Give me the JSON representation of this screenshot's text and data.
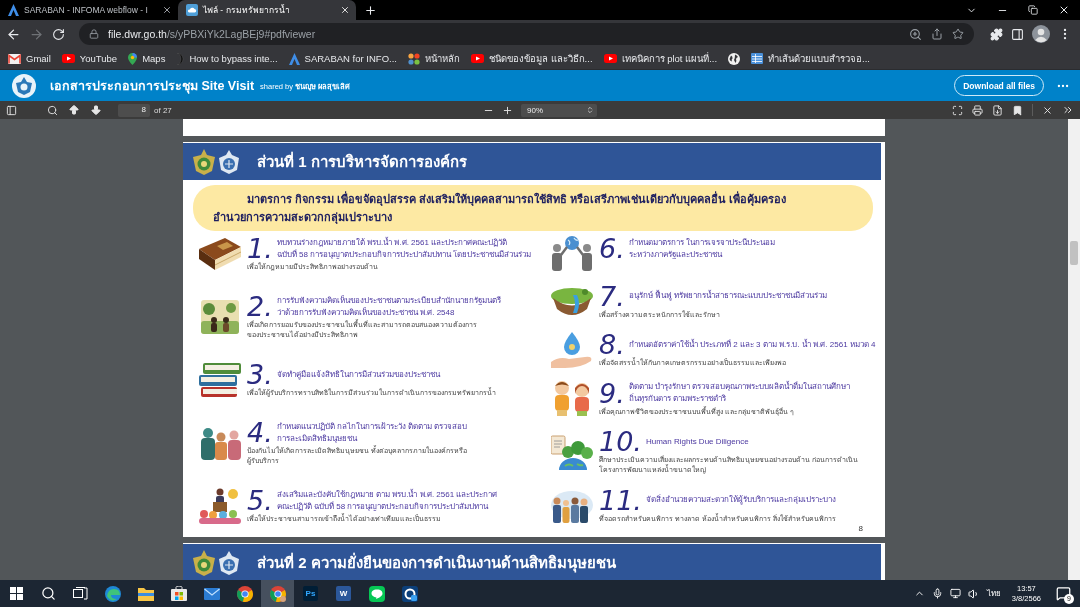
{
  "browser": {
    "tabs": [
      {
        "title": "SARABAN - INFOMA webflow - I",
        "kind": "saraban",
        "selected": false
      },
      {
        "title": "ไฟล์ - กรมทรัพยากรน้ำ",
        "kind": "cloud",
        "selected": true
      }
    ],
    "forward_disabled": true,
    "address": {
      "host": "file.dwr.go.th",
      "path": "/s/yPBXiYk2LagBEj9#pdfviewer"
    },
    "bookmarks": [
      {
        "kind": "gmail",
        "label": "Gmail"
      },
      {
        "kind": "youtube",
        "label": "YouTube"
      },
      {
        "kind": "maps",
        "label": "Maps"
      },
      {
        "kind": "dark",
        "label": "How to bypass inte..."
      },
      {
        "kind": "saraban",
        "label": "SARABAN for INFO..."
      },
      {
        "kind": "joomla",
        "label": "หน้าหลัก"
      },
      {
        "kind": "youtube",
        "label": "ชนิดของข้อมูล และวิธีก..."
      },
      {
        "kind": "youtube",
        "label": "เทคนิคการ plot แผนที่..."
      },
      {
        "kind": "globe"
      },
      {
        "kind": "sheet",
        "label": "ทำเส้นด้วยแบบสำรวจอ..."
      }
    ]
  },
  "share_header": {
    "title": "เอกสารประกอบการประชุม Site Visit",
    "shared_by": "shared by **ชนญุษ ผลสุขเลิศ**",
    "download_button": "Download all files"
  },
  "pdf_toolbar": {
    "page": "8",
    "page_count": "of 27",
    "zoom": "90%"
  },
  "document": {
    "page": {
      "section_title": "ส่วนที่ 1 การบริหารจัดการองค์กร",
      "intro": "มาตรการ กิจกรรม เพื่อขจัดอุปสรรค ส่งเสริมให้บุคคลสามารถใช้สิทธิ หรือเสรีภาพเช่นเดียวกับบุคคลอื่น เพื่อคุ้มครอง\nอำนวยการความสะดวกกลุ่มเปราะบาง",
      "columns": [
        {
          "items": [
            {
              "kind": "law-book",
              "number": "1.",
              "title": "ทบทวนร่างกฎหมายภายใต้ พรบ.น้ำ พ.ศ. 2561 และประกาศคณะปฏิวัติ\nฉบับที่ 58 การอนุญาตประกอบกิจการประปาสัมปทาน โดยประชาชนมีส่วนร่วม",
              "note": "เพื่อให้กฎหมายมีประสิทธิภาพอย่างรอบด้าน"
            },
            {
              "kind": "village",
              "number": "2.",
              "title": "การรับฟังความคิดเห็นของประชาชนตามระเบียบสำนักนายกรัฐมนตรี\nว่าด้วยการรับฟังความคิดเห็นของประชาชน พ.ศ. 2548",
              "note": "เพื่อเกิดการยอมรับของประชาชนในพื้นที่และสามารถตอบสนองความต้องการ\nของประชาชนได้อย่างมีประสิทธิภาพ"
            },
            {
              "kind": "books",
              "number": "3.",
              "title": "จัดทำคู่มือแจ้งสิทธิในการมีส่วนร่วมของประชาชน",
              "note": "เพื่อให้ผู้รับบริการทราบสิทธิในการมีส่วนร่วมในการดำเนินการของกรมทรัพยากรน้ำ"
            },
            {
              "kind": "meeting",
              "number": "4.",
              "title": "กำหนดแนวปฏิบัติ กลไกในการเฝ้าระวัง ติดตาม ตรวจสอบ\nการละเมิดสิทธิมนุษยชน",
              "note": "ป้องกันไม่ให้เกิดการละเมิดสิทธิมนุษยชน ทั้งต่อบุคลากรภายในองค์กรหรือ\nผู้รับบริการ"
            },
            {
              "kind": "speaker",
              "number": "5.",
              "title": "ส่งเสริมและบังคับใช้กฎหมาย ตาม พรบ.น้ำ พ.ศ. 2561 และประกาศ\nคณะปฏิวัติ ฉบับที่ 58 การอนุญาตประกอบกิจการประปาสัมปทาน",
              "note": "เพื่อให้ประชาชนสามารถเข้าถึงน้ำได้อย่างเท่าเทียมและเป็นธรรม"
            }
          ]
        },
        {
          "items": [
            {
              "kind": "globe-people",
              "number": "6.",
              "title": "กำหนดมาตรการ ในการเจรจาประนีประนอม\nระหว่างภาครัฐและประชาชน"
            },
            {
              "kind": "island",
              "number": "7.",
              "title": "อนุรักษ์ ฟื้นฟู ทรัพยากรน้ำสาธารณะแบบประชาชนมีส่วนร่วม",
              "note": "เพื่อสร้างความตระหนักการใช้และรักษา"
            },
            {
              "kind": "water-hand",
              "number": "8.",
              "title": "กำหนดอัตราค่าใช้น้ำ ประเภทที่ 2 และ 3 ตาม พ.ร.บ. น้ำ พ.ศ. 2561 หมวด 4",
              "note": "เพื่อจัดสรรน้ำให้กับภาคเกษตรกรรมอย่างเป็นธรรมและเพียงพอ"
            },
            {
              "kind": "children",
              "number": "9.",
              "title": "ติดตาม บำรุงรักษา ตรวจสอบคุณภาพระบบผลิตน้ำดื่มในสถานศึกษา\nถิ่นทุรกันดาร ตามพระราชดำริ",
              "note": "เพื่อคุณภาพชีวิตของประชาชนบนพื้นที่สูง และกลุ่มชาติพันธุ์อื่น ๆ"
            },
            {
              "kind": "earth",
              "number": "10.",
              "title": "Human Rights Due Diligence",
              "note": "ศึกษาประเมินความเสี่ยงและผลกระทบด้านสิทธิมนุษยชนอย่างรอบด้าน ก่อนการดำเนิน\nโครงการพัฒนาแหล่งน้ำขนาดใหญ่"
            },
            {
              "kind": "crowd",
              "number": "11.",
              "title": "จัดสิ่งอำนวยความสะดวกให้ผู้รับบริการและกลุ่มเปราะบาง",
              "note": "ที่จอดรถสำหรับคนพิการ ทางลาด ห้องน้ำสำหรับคนพิการ สิ่งใช้สำหรับคนพิการ"
            }
          ]
        }
      ],
      "page_number": "8"
    },
    "next_page": {
      "section_title": "ส่วนที่ 2 ความยั่งยืนของการดำเนินงานด้านสิทธิมนุษยชน"
    }
  },
  "taskbar": {
    "apps": [
      {
        "kind": "edge",
        "selected": false
      },
      {
        "kind": "explorer",
        "selected": false
      },
      {
        "kind": "store",
        "selected": false
      },
      {
        "kind": "mail",
        "selected": false
      },
      {
        "kind": "chrome",
        "selected": false
      },
      {
        "kind": "chrome-profile",
        "selected": true
      },
      {
        "kind": "photoshop",
        "glyph": "Ps",
        "selected": false
      },
      {
        "kind": "word",
        "glyph": "W",
        "selected": false
      },
      {
        "kind": "line",
        "selected": false
      },
      {
        "kind": "remote",
        "selected": false
      }
    ],
    "tray": {
      "language": "ไทย",
      "time": "13:57",
      "date": "3/8/2566",
      "notifications": "9"
    }
  }
}
